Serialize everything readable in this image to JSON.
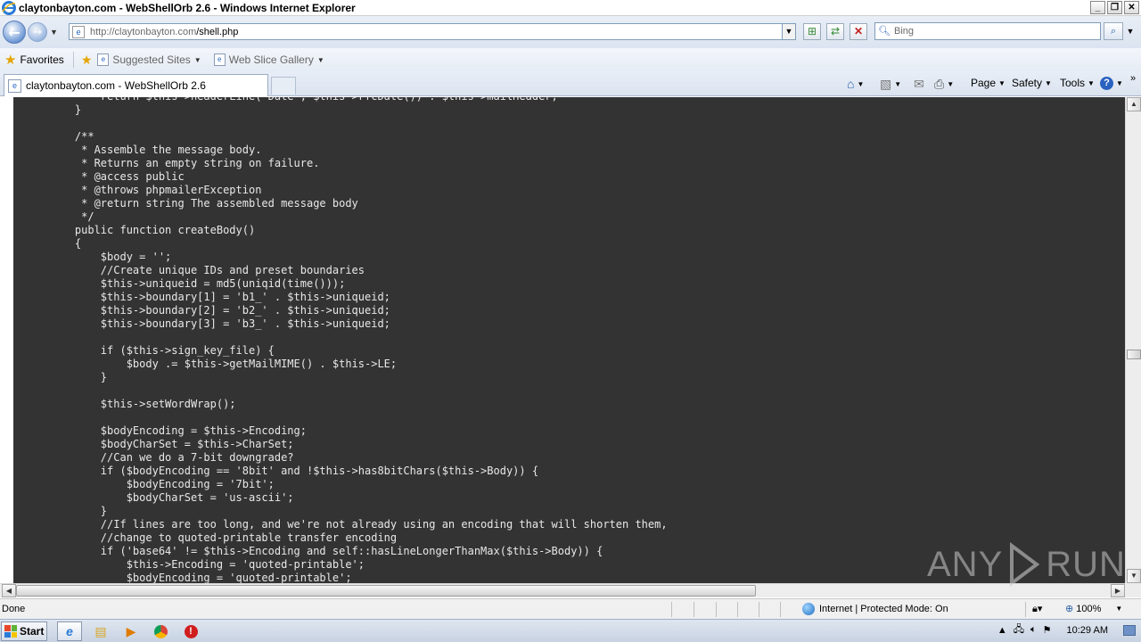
{
  "window": {
    "title": "claytonbayton.com - WebShellOrb 2.6 - Windows Internet Explorer",
    "controls": [
      "_",
      "❐",
      "✕"
    ]
  },
  "navigation": {
    "url_domain": "http://claytonbayton.com",
    "url_path": "/shell.php",
    "search_placeholder": "Bing"
  },
  "favorites_bar": {
    "favorites_label": "Favorites",
    "suggested_sites_label": "Suggested Sites",
    "web_slice_gallery_label": "Web Slice Gallery"
  },
  "tab": {
    "label": "claytonbayton.com - WebShellOrb 2.6"
  },
  "command_bar": {
    "page_label": "Page",
    "safety_label": "Safety",
    "tools_label": "Tools"
  },
  "code_lines": [
    "        return $this->headerLine('Date', $this->rfcDate()) . $this->mailHeader;",
    "    }",
    "",
    "    /**",
    "     * Assemble the message body.",
    "     * Returns an empty string on failure.",
    "     * @access public",
    "     * @throws phpmailerException",
    "     * @return string The assembled message body",
    "     */",
    "    public function createBody()",
    "    {",
    "        $body = '';",
    "        //Create unique IDs and preset boundaries",
    "        $this->uniqueid = md5(uniqid(time()));",
    "        $this->boundary[1] = 'b1_' . $this->uniqueid;",
    "        $this->boundary[2] = 'b2_' . $this->uniqueid;",
    "        $this->boundary[3] = 'b3_' . $this->uniqueid;",
    "",
    "        if ($this->sign_key_file) {",
    "            $body .= $this->getMailMIME() . $this->LE;",
    "        }",
    "",
    "        $this->setWordWrap();",
    "",
    "        $bodyEncoding = $this->Encoding;",
    "        $bodyCharSet = $this->CharSet;",
    "        //Can we do a 7-bit downgrade?",
    "        if ($bodyEncoding == '8bit' and !$this->has8bitChars($this->Body)) {",
    "            $bodyEncoding = '7bit';",
    "            $bodyCharSet = 'us-ascii';",
    "        }",
    "        //If lines are too long, and we're not already using an encoding that will shorten them,",
    "        //change to quoted-printable transfer encoding",
    "        if ('base64' != $this->Encoding and self::hasLineLongerThanMax($this->Body)) {",
    "            $this->Encoding = 'quoted-printable';",
    "            $bodyEncoding = 'quoted-printable';"
  ],
  "watermark": {
    "left": "ANY",
    "right": "RUN"
  },
  "statusbar": {
    "status_text": "Done",
    "zone_text": "Internet | Protected Mode: On",
    "zoom_text": "100%"
  },
  "taskbar": {
    "start_label": "Start",
    "clock": "10:29 AM"
  }
}
